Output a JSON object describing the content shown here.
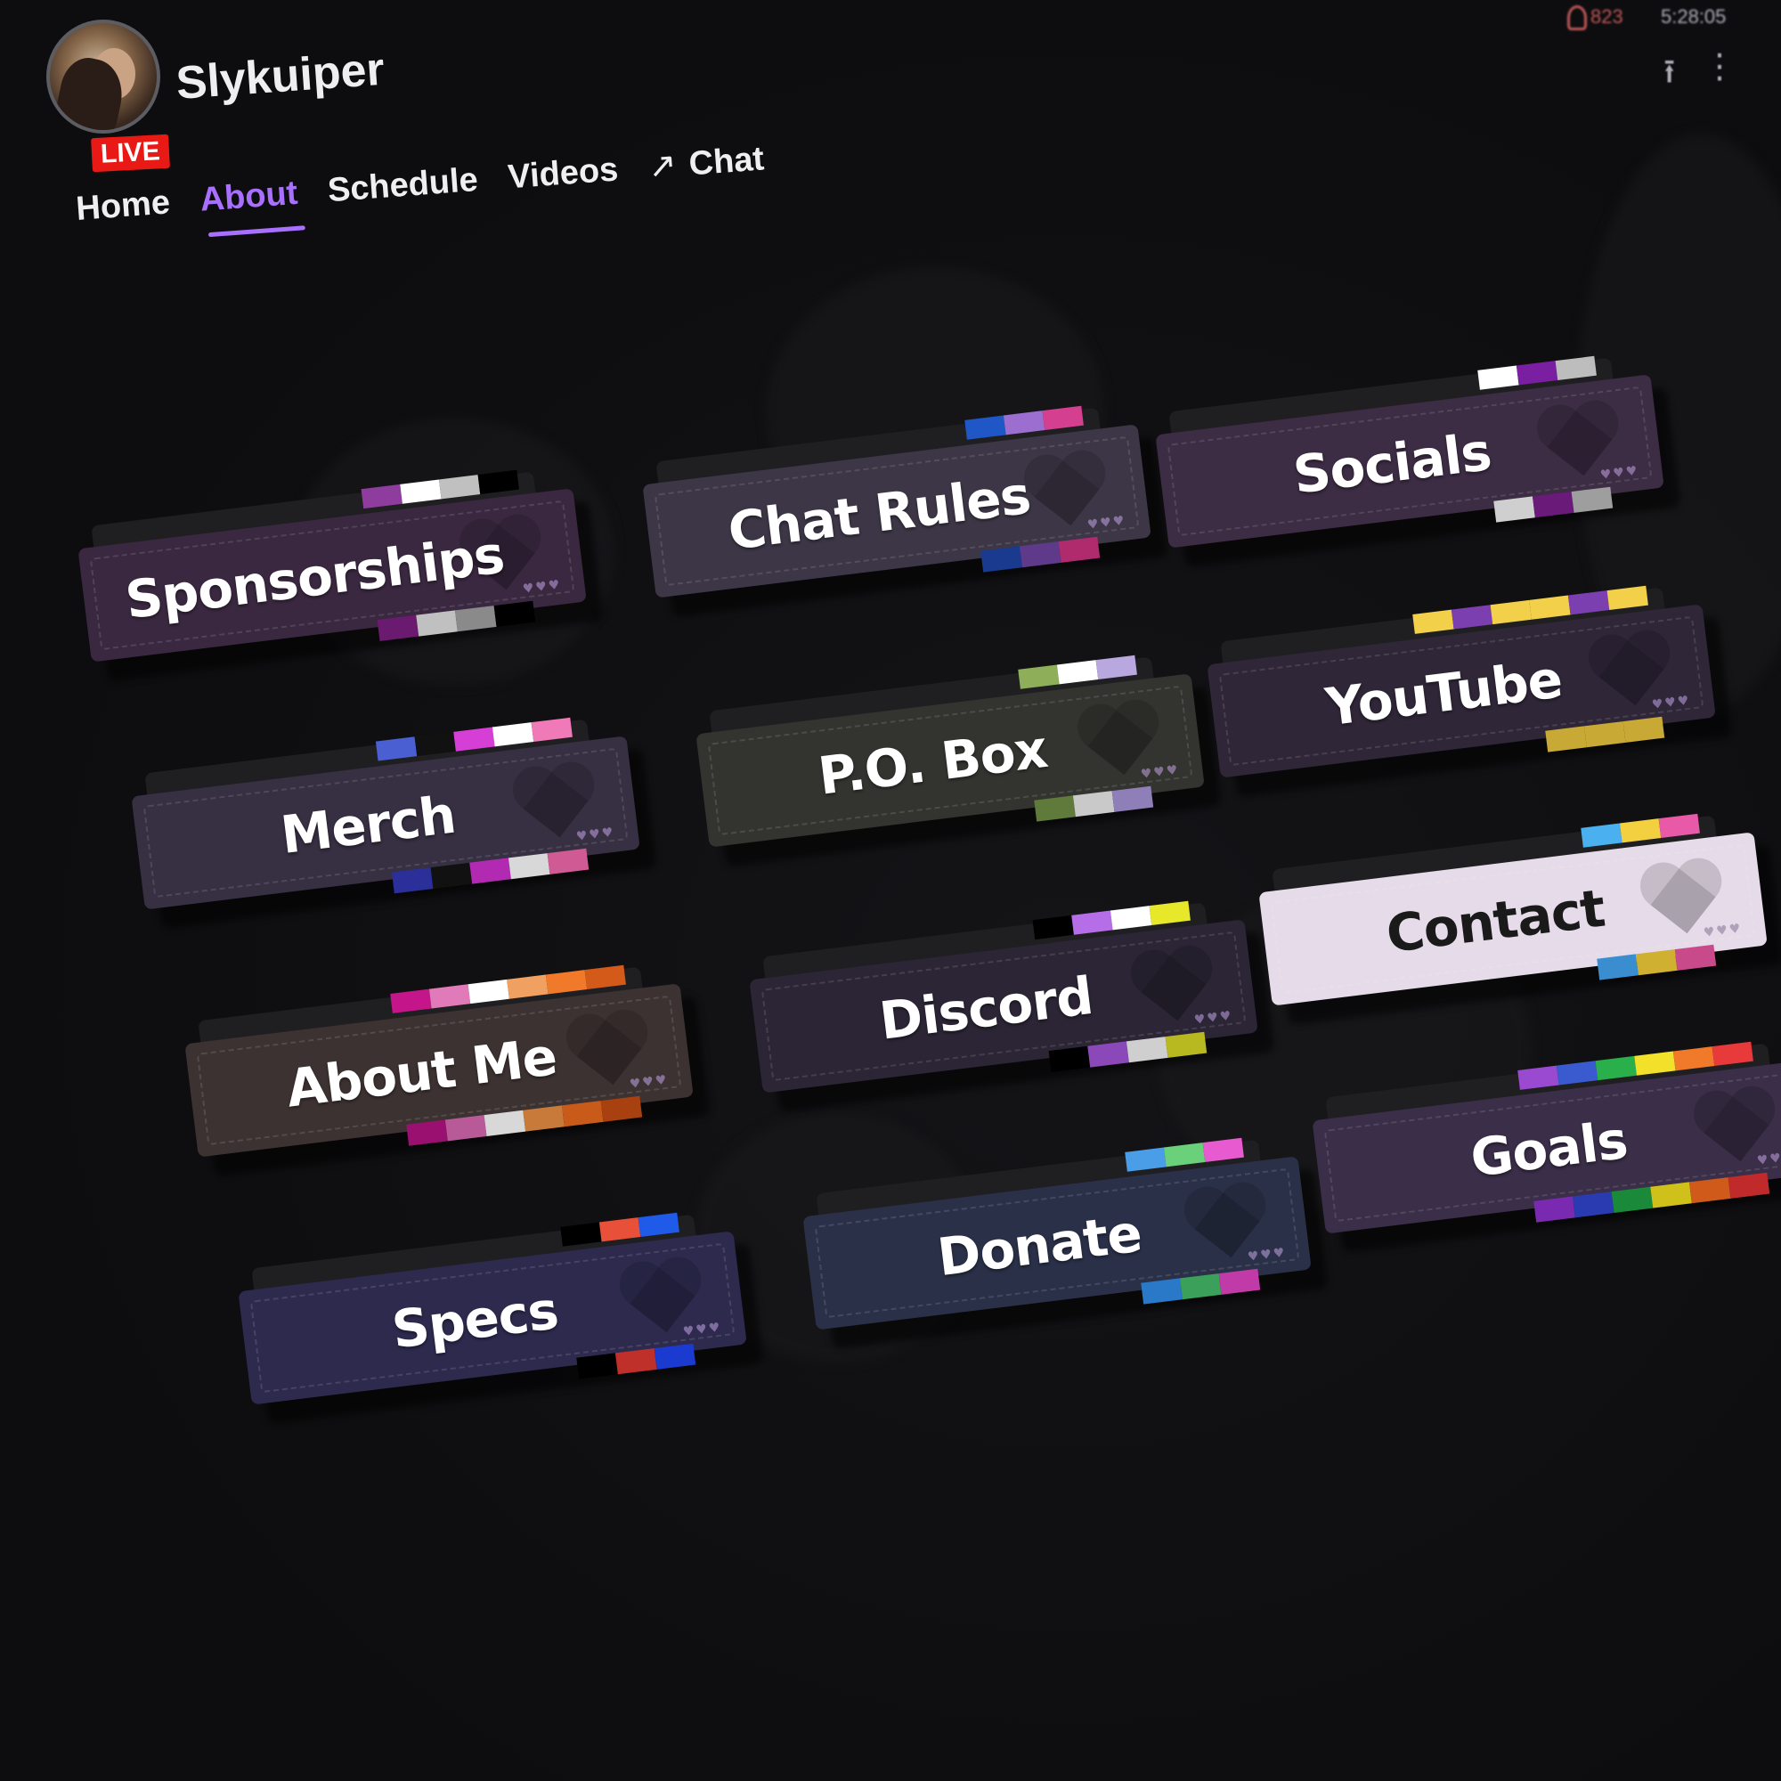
{
  "channel": {
    "name": "Slykuiper",
    "live_label": "LIVE",
    "viewer_count": "823",
    "uptime": "5:28:05"
  },
  "nav": {
    "items": [
      {
        "label": "Home",
        "active": false
      },
      {
        "label": "About",
        "active": true
      },
      {
        "label": "Schedule",
        "active": false
      },
      {
        "label": "Videos",
        "active": false
      },
      {
        "label": "Chat",
        "active": false,
        "icon": "external-arrow-icon"
      }
    ]
  },
  "colors": {
    "accent": "#a970ff",
    "live": "#e91916",
    "background": "#0e0e10",
    "text": "#efeff1"
  },
  "panels": [
    {
      "label": "Sponsorships",
      "bg": "#3a2840",
      "stripe_top": [
        "#8e3d9e",
        "#ffffff",
        "#c0c0c0",
        "#000000"
      ],
      "stripe_bottom": [
        "#6a1b6f",
        "#c0c0c0",
        "#8a8a8a",
        "#000000"
      ]
    },
    {
      "label": "Chat Rules",
      "bg": "#3d3646",
      "stripe_top": [
        "#1f57c7",
        "#9b6ecf",
        "#d4408f"
      ],
      "stripe_bottom": [
        "#1a3a8f",
        "#5f3a8a",
        "#b02a6e"
      ]
    },
    {
      "label": "Socials",
      "bg": "#3c2c44",
      "stripe_top": [
        "#ffffff",
        "#7b1fa2",
        "#bdbdbd"
      ],
      "stripe_bottom": [
        "#cfcfcf",
        "#6a1b7a",
        "#9e9e9e"
      ]
    },
    {
      "label": "Merch",
      "bg": "#372f42",
      "stripe_top": [
        "#4a5fd1",
        "#111111",
        "#d63fd6",
        "#ffffff",
        "#f07ab8"
      ],
      "stripe_bottom": [
        "#2a2f9a",
        "#111111",
        "#b22ab2",
        "#d8d8d8",
        "#d05a94"
      ]
    },
    {
      "label": "P.O. Box",
      "bg": "#33342f",
      "stripe_top": [
        "#8fae5a",
        "#ffffff",
        "#b9a7e0"
      ],
      "stripe_bottom": [
        "#5f7a3a",
        "#c9c9c9",
        "#8f7fb8"
      ]
    },
    {
      "label": "YouTube",
      "bg": "#2f2638",
      "stripe_top": [
        "#f2d04a",
        "#7b3fb0",
        "#f2d04a",
        "#f2d04a",
        "#7b3fb0",
        "#f2d04a"
      ],
      "stripe_bottom": [
        "#c9a935",
        "#c9a935",
        "#c9a935"
      ]
    },
    {
      "label": "About Me",
      "bg": "#3d3232",
      "stripe_top": [
        "#c4158a",
        "#e07ab8",
        "#ffffff",
        "#f0a060",
        "#f07a2a",
        "#d45a1a"
      ],
      "stripe_bottom": [
        "#9a1070",
        "#b85a98",
        "#d8d8d8",
        "#c87a3a",
        "#c85a1a",
        "#a8400f"
      ]
    },
    {
      "label": "Discord",
      "bg": "#2b2535",
      "stripe_top": [
        "#000000",
        "#b66ee8",
        "#ffffff",
        "#e8e82a"
      ],
      "stripe_bottom": [
        "#000000",
        "#8a48b8",
        "#cfcfcf",
        "#b8b820"
      ]
    },
    {
      "label": "Contact",
      "bg": "#e6dbe8",
      "text_color": "#1a1a1a",
      "stripe_top": [
        "#4ab0f0",
        "#f2d040",
        "#e85aa8"
      ],
      "stripe_bottom": [
        "#3a8ed0",
        "#d0b030",
        "#c84a8a"
      ]
    },
    {
      "label": "Specs",
      "bg": "#2d2a4e",
      "stripe_top": [
        "#000000",
        "#e8503a",
        "#1f5ae8"
      ],
      "stripe_bottom": [
        "#000000",
        "#c0302a",
        "#1a3ad0"
      ]
    },
    {
      "label": "Donate",
      "bg": "#2a3048",
      "stripe_top": [
        "#4a9ee8",
        "#6ad07a",
        "#e85ad0"
      ],
      "stripe_bottom": [
        "#2a78c8",
        "#3aa05a",
        "#c03aa8"
      ]
    },
    {
      "label": "Goals",
      "bg": "#3a2e48",
      "stripe_top": [
        "#9a4ad0",
        "#3a5ad0",
        "#2ab04a",
        "#f2e02a",
        "#f07a2a",
        "#e83a3a"
      ],
      "stripe_bottom": [
        "#7a2ab0",
        "#2a3ab0",
        "#1a8a3a",
        "#d0c01a",
        "#d05a1a",
        "#c02a2a"
      ]
    }
  ]
}
